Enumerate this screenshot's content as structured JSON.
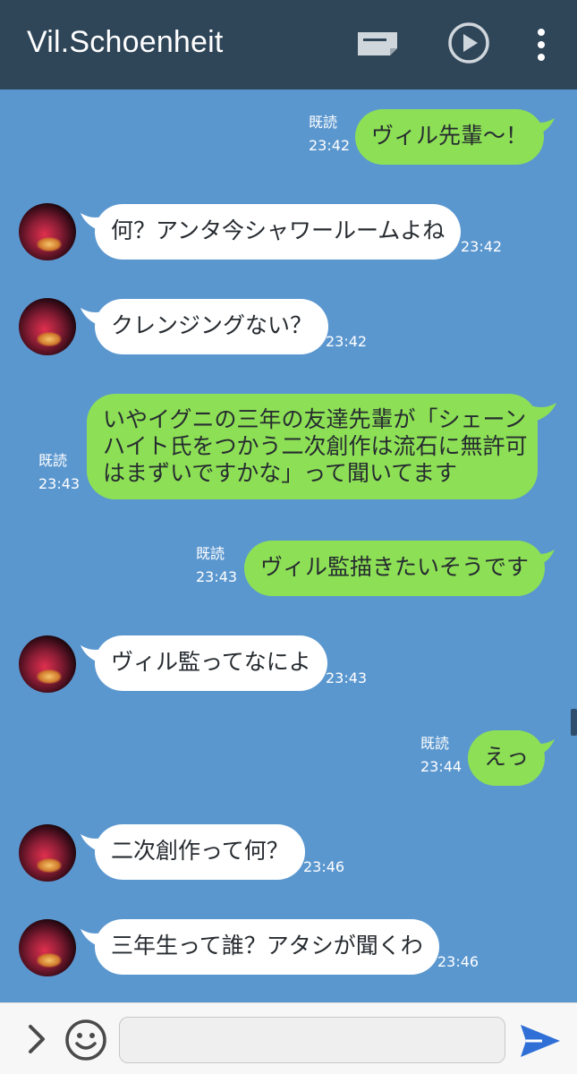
{
  "header": {
    "title": "Vil.Schoenheit"
  },
  "messages": [
    {
      "from": "me",
      "text": "ヴィル先輩～！",
      "read": "既読",
      "time": "23:42"
    },
    {
      "from": "them",
      "text": "何？アンタ今シャワールームよね",
      "time": "23:42"
    },
    {
      "from": "them",
      "text": "クレンジングない？",
      "time": "23:42"
    },
    {
      "from": "me",
      "lines": [
        "いやイグニの三年の友達先輩が「シェーン",
        "ハイト氏をつかう二次創作は流石に無許可",
        "はまずいですかな」って聞いてます"
      ],
      "read": "既読",
      "time": "23:43"
    },
    {
      "from": "me",
      "text": "ヴィル監描きたいそうです",
      "read": "既読",
      "time": "23:43"
    },
    {
      "from": "them",
      "text": "ヴィル監ってなによ",
      "time": "23:43"
    },
    {
      "from": "me",
      "text": "えっ",
      "read": "既読",
      "time": "23:44"
    },
    {
      "from": "them",
      "text": "二次創作って何？",
      "time": "23:46"
    },
    {
      "from": "them",
      "text": "三年生って誰？アタシが聞くわ",
      "time": "23:46"
    }
  ],
  "input": {
    "placeholder": ""
  },
  "icons": {
    "keep": "note-icon",
    "play": "play-circle-icon",
    "more": "more-vertical-icon",
    "expand": "chevron-right-icon",
    "emoji": "emoji-icon",
    "send": "send-icon"
  },
  "colors": {
    "header_bg": "#2f4558",
    "chat_bg": "#5b97cf",
    "my_bubble": "#8de055",
    "their_bubble": "#ffffff",
    "send_accent": "#2f6fd6"
  }
}
